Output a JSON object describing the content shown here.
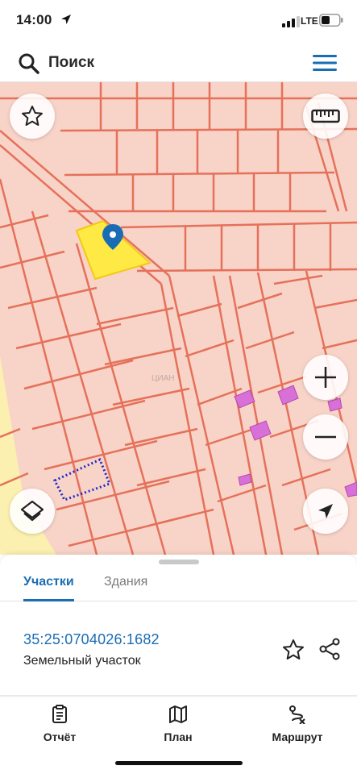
{
  "status_bar": {
    "time": "14:00",
    "network": "LTE"
  },
  "search": {
    "placeholder": "Поиск"
  },
  "map": {
    "watermark": "ЦИАН",
    "colors": {
      "parcel_fill": "#f8d3c8",
      "parcel_border": "#e5715a",
      "selected_parcel": "#ffea45",
      "building": "#d870d8",
      "marker": "#1a6db3"
    },
    "icons": [
      "star-icon",
      "ruler-icon",
      "plus-icon",
      "minus-icon",
      "layers-icon",
      "navigation-arrow-icon",
      "map-pin-icon"
    ]
  },
  "sheet": {
    "tabs": [
      {
        "label": "Участки",
        "active": true
      },
      {
        "label": "Здания",
        "active": false
      }
    ],
    "parcel": {
      "number": "35:25:0704026:1682",
      "type": "Земельный участок"
    }
  },
  "bottom_nav": {
    "items": [
      {
        "label": "Отчёт",
        "icon": "report-icon"
      },
      {
        "label": "План",
        "icon": "map-icon"
      },
      {
        "label": "Маршрут",
        "icon": "route-icon"
      }
    ]
  },
  "colors": {
    "accent": "#1a6db3"
  }
}
